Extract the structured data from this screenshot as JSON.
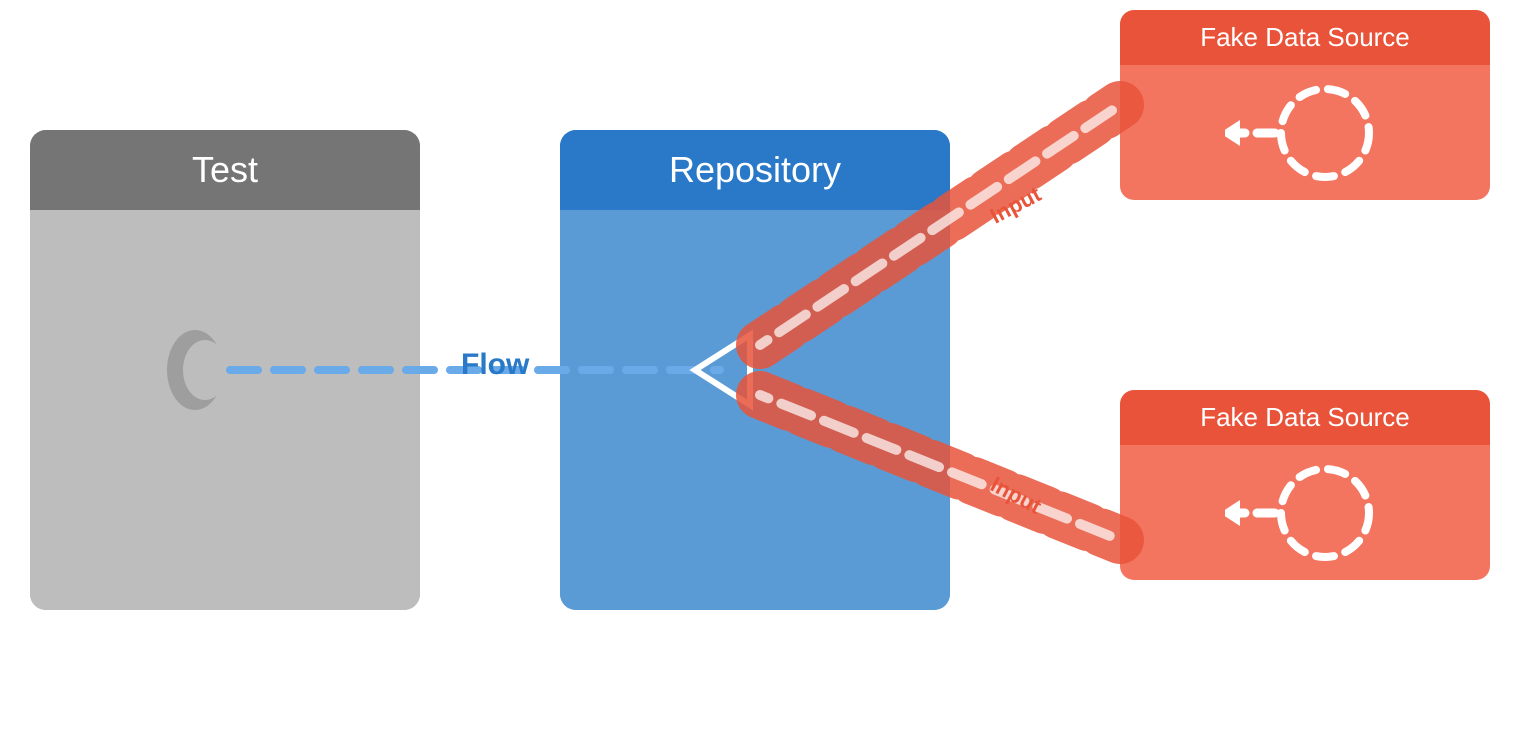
{
  "test_block": {
    "header_label": "Test"
  },
  "repo_block": {
    "header_label": "Repository"
  },
  "fds_top": {
    "header_label": "Fake Data Source"
  },
  "fds_bottom": {
    "header_label": "Fake Data Source"
  },
  "flow_label": "Flow",
  "input_label_top": "Input",
  "input_label_bottom": "Input",
  "colors": {
    "test_header": "#757575",
    "test_body": "#bdbdbd",
    "repo_header": "#2979c8",
    "repo_body": "#5b9bd5",
    "fds_header": "#e8533a",
    "fds_body": "#f4755f",
    "flow_color": "#2979c8",
    "input_color": "#e8533a",
    "dashed_line_blue": "#6aaae8",
    "dashed_line_orange": "#f4956c"
  }
}
